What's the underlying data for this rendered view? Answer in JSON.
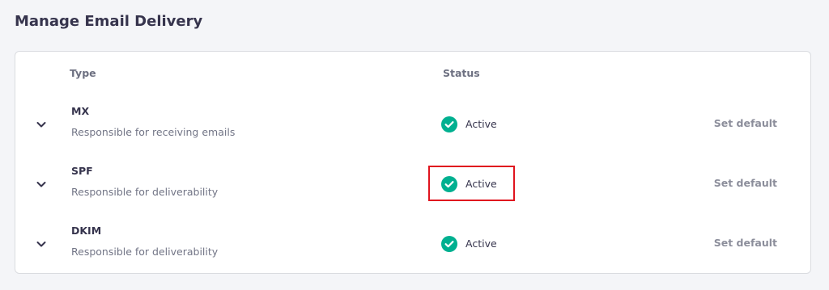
{
  "page": {
    "title": "Manage Email Delivery"
  },
  "table": {
    "headers": {
      "type": "Type",
      "status": "Status"
    },
    "rows": [
      {
        "name": "MX",
        "description": "Responsible for receiving emails",
        "status": "Active",
        "action": "Set default",
        "highlighted": false
      },
      {
        "name": "SPF",
        "description": "Responsible for deliverability",
        "status": "Active",
        "action": "Set default",
        "highlighted": true
      },
      {
        "name": "DKIM",
        "description": "Responsible for deliverability",
        "status": "Active",
        "action": "Set default",
        "highlighted": false
      }
    ]
  },
  "colors": {
    "status_active": "#00b090",
    "highlight": "#e0141e"
  },
  "icons": {
    "expand": "chevron-down-icon",
    "status": "check-circle-icon"
  }
}
